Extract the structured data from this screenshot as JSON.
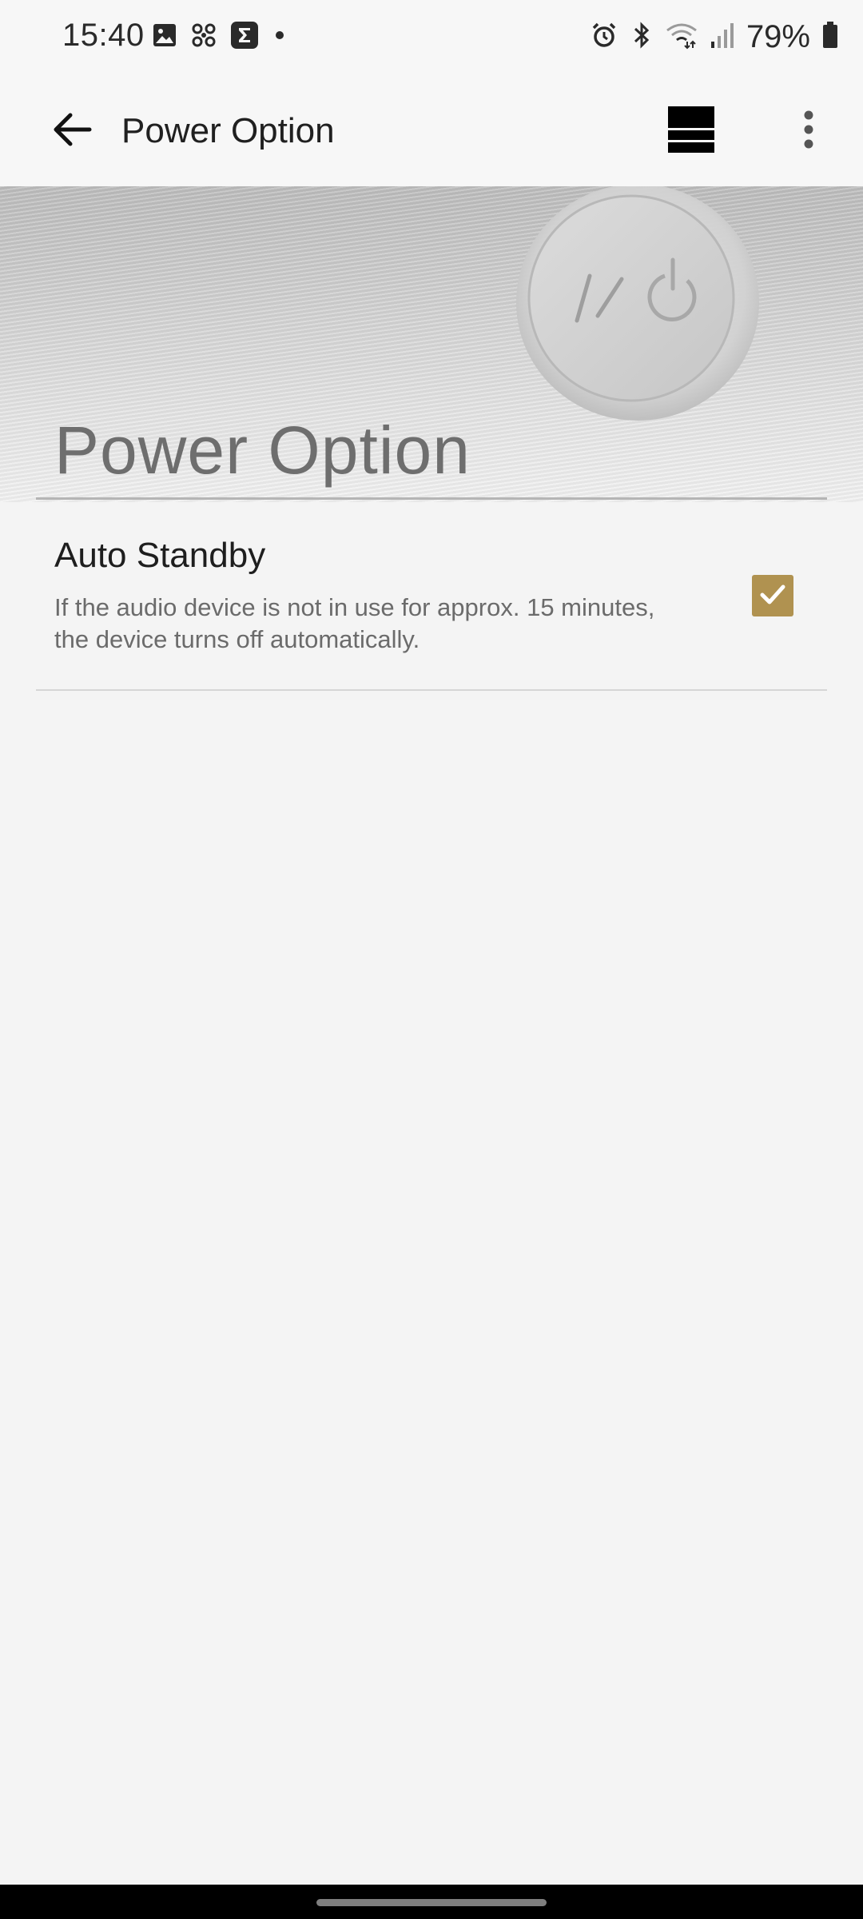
{
  "status_bar": {
    "time": "15:40",
    "battery_percent": "79%",
    "left_icons": [
      "image-icon",
      "fan-icon",
      "sigma-app-icon",
      "dot-icon"
    ],
    "right_icons": [
      "alarm-icon",
      "bluetooth-icon",
      "wifi-icon",
      "signal-icon",
      "battery-icon"
    ]
  },
  "app_bar": {
    "title": "Power Option",
    "back_icon": "arrow-left-icon",
    "stack_icon": "stack-icon",
    "more_icon": "more-vertical-icon"
  },
  "banner": {
    "title": "Power Option"
  },
  "settings": [
    {
      "title": "Auto Standby",
      "description": "If the audio device is not in use for approx. 15 minutes, the device turns off automatically.",
      "checked": true
    }
  ],
  "colors": {
    "accent": "#b09250",
    "background": "#f4f4f4",
    "app_bar": "#f7f7f7"
  }
}
